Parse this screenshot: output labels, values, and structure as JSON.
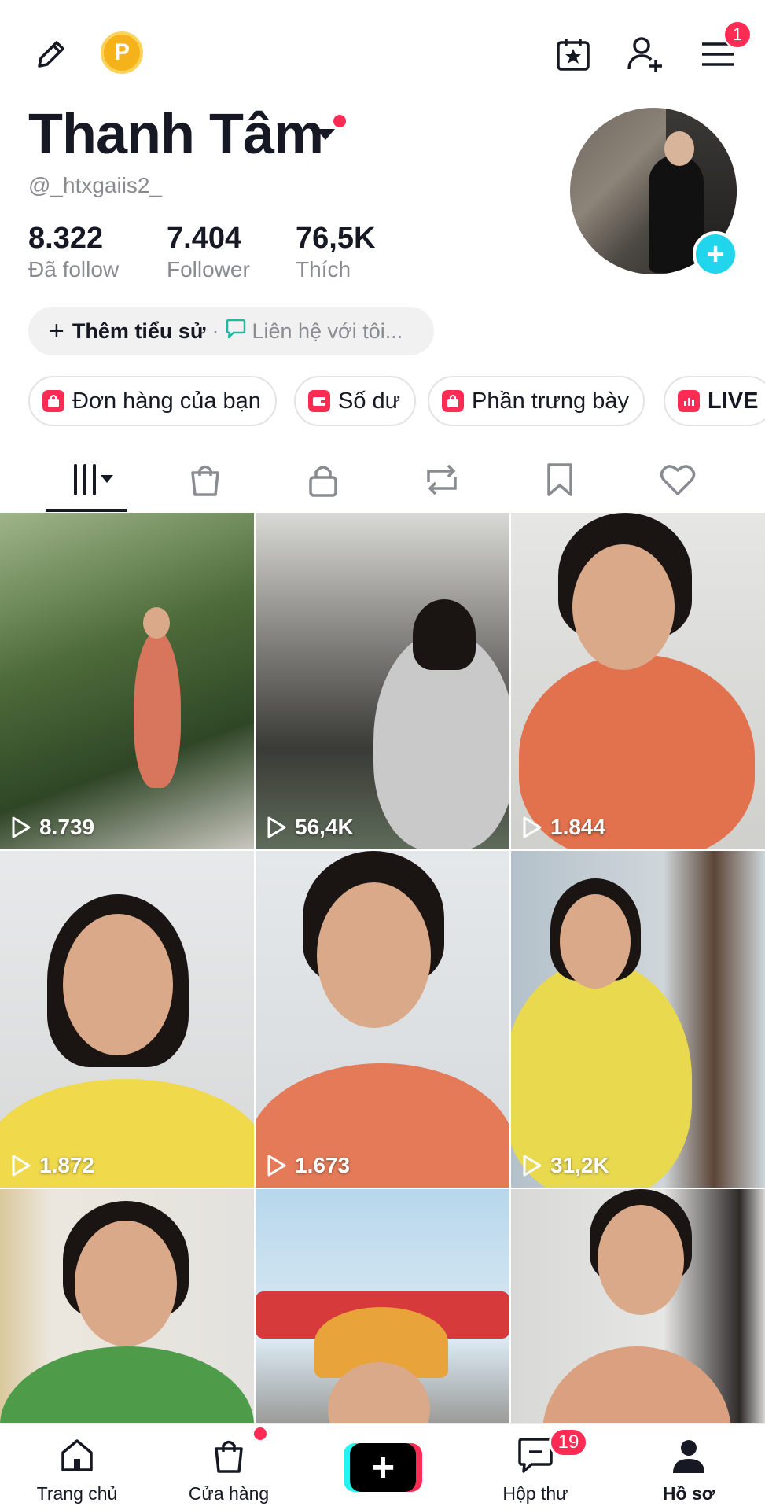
{
  "topbar": {
    "coin_letter": "P",
    "menu_badge": "1"
  },
  "profile": {
    "name": "Thanh Tâm",
    "handle": "@_htxgaiis2_",
    "stats": [
      {
        "value": "8.322",
        "label": "Đã follow"
      },
      {
        "value": "7.404",
        "label": "Follower"
      },
      {
        "value": "76,5K",
        "label": "Thích"
      }
    ],
    "add_bio": "Thêm tiểu sử",
    "separator": "·",
    "contact": "Liên hệ với tôi..."
  },
  "chips": [
    {
      "label": "Đơn hàng của bạn",
      "icon": "bag-icon"
    },
    {
      "label": "Số dư",
      "icon": "wallet-icon"
    },
    {
      "label": "Phần trưng bày",
      "icon": "showcase-icon"
    },
    {
      "label": "LIVE",
      "icon": "live-chart-icon"
    }
  ],
  "tabs": [
    "videos-grid-icon",
    "shop-bag-icon",
    "lock-icon",
    "repost-icon",
    "bookmark-icon",
    "heart-icon"
  ],
  "videos": [
    {
      "views": "8.739"
    },
    {
      "views": "56,4K"
    },
    {
      "views": "1.844"
    },
    {
      "views": "1.872"
    },
    {
      "views": "1.673"
    },
    {
      "views": "31,2K"
    },
    {
      "views": ""
    },
    {
      "views": ""
    },
    {
      "views": ""
    }
  ],
  "bottom_nav": {
    "home": "Trang chủ",
    "shop": "Cửa hàng",
    "inbox": "Hộp thư",
    "inbox_badge": "19",
    "profile": "Hồ sơ"
  },
  "colors": {
    "accent": "#fe2c55",
    "cyan": "#25f4ee",
    "text": "#161823",
    "muted": "#8a8b91"
  }
}
